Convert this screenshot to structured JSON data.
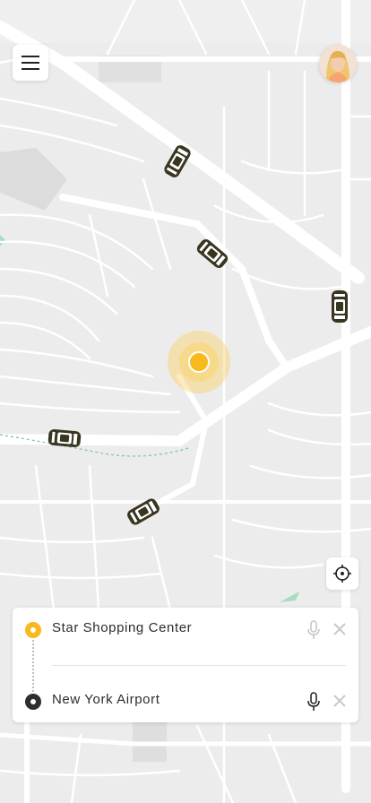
{
  "map": {
    "region": "city-map",
    "pickup_marker_icon": "current-location-marker",
    "car_icon": "taxi-car-icon",
    "colors": {
      "background": "#ececec",
      "road": "#ffffff",
      "accent": "#f7b91b",
      "park": "#9fd8b8",
      "car": "#3a3520"
    },
    "cars": [
      {
        "id": "car-1"
      },
      {
        "id": "car-2"
      },
      {
        "id": "car-3"
      },
      {
        "id": "car-4"
      },
      {
        "id": "car-5"
      }
    ]
  },
  "header": {
    "menu_icon": "hamburger-menu-icon",
    "avatar_icon": "user-avatar"
  },
  "controls": {
    "locate_icon": "crosshair-icon"
  },
  "route": {
    "pickup": {
      "label": "Star Shopping Center",
      "mic_icon": "microphone-icon",
      "clear_icon": "close-icon"
    },
    "dropoff": {
      "label": "New York Airport",
      "mic_icon": "microphone-icon",
      "clear_icon": "close-icon"
    }
  }
}
